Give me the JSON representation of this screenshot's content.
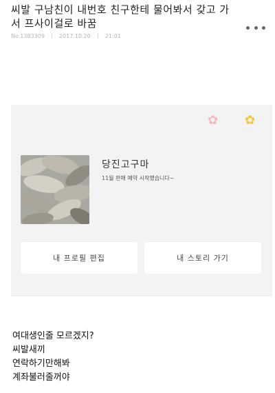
{
  "post": {
    "title": "씨발 구남친이 내번호 친구한테 물어봐서 갖고 가서 프사이걸로 바꿈",
    "meta_id": "No.1383309",
    "meta_date": "2017.10.20",
    "meta_time": "21:01"
  },
  "profile_card": {
    "name": "당진고구마",
    "status": "11월 판매 예약 시작했습니다~",
    "edit_button": "내 프로필 편집",
    "story_button": "내 스토리 가기",
    "icons": [
      "flower-pink",
      "flower-yellow"
    ],
    "colors": {
      "card_bg": "#f3f3f3",
      "flower_pink": "#f2b8bd",
      "flower_yellow": "#f1c732"
    }
  },
  "message_lines": [
    "여대생인줄 모르겠지?",
    "씨발새끼",
    "연락하기만해봐",
    "계좌불러줄꺼야"
  ]
}
